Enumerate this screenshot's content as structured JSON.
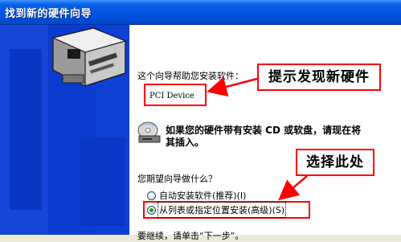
{
  "window": {
    "title": "找到新的硬件向导"
  },
  "content": {
    "intro": "这个向导帮助您安装软件：",
    "device_name": "PCI Device",
    "cd_prompt_line1": "如果您的硬件带有安装 CD 或软盘，请现在将",
    "cd_prompt_line2": "其插入。",
    "question": "您期望向导做什么？",
    "option_auto": "自动安装软件(推荐)(I)",
    "option_list": "从列表或指定位置安装(高级)(S)",
    "footer_partial": "要继续，请单击“下一步”。"
  },
  "annotations": {
    "callout_found": "提示发现新硬件",
    "callout_select": "选择此处"
  },
  "colors": {
    "titlebar": "#0055e5",
    "left_panel": "#0b3bd0",
    "annotation_red": "#ff0000",
    "radio_selected": "#21a121"
  },
  "icons": [
    "hardware-wizard-icon",
    "cd-disk-icon"
  ],
  "state": {
    "selected_option": "option_list"
  }
}
